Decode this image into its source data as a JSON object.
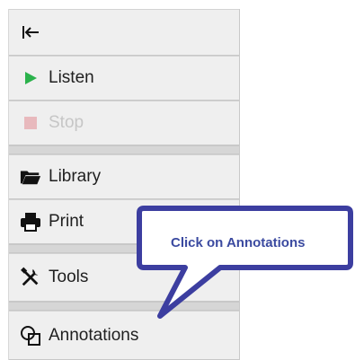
{
  "toolbar": {
    "collapse_label": "",
    "items": [
      {
        "label": "Listen",
        "icon": "play-icon",
        "enabled": true,
        "icon_color": "#2bb24c"
      },
      {
        "label": "Stop",
        "icon": "stop-icon",
        "enabled": false,
        "icon_color": "#e8b9bd"
      },
      {
        "label": "Library",
        "icon": "folder-icon",
        "enabled": true
      },
      {
        "label": "Print",
        "icon": "printer-icon",
        "enabled": true
      },
      {
        "label": "Tools",
        "icon": "tools-icon",
        "enabled": true
      },
      {
        "label": "Annotations",
        "icon": "annotations-icon",
        "enabled": true
      }
    ]
  },
  "callout": {
    "text": "Click on Annotations",
    "border_color": "#3c3ea0",
    "text_color": "#3b4aa0"
  }
}
